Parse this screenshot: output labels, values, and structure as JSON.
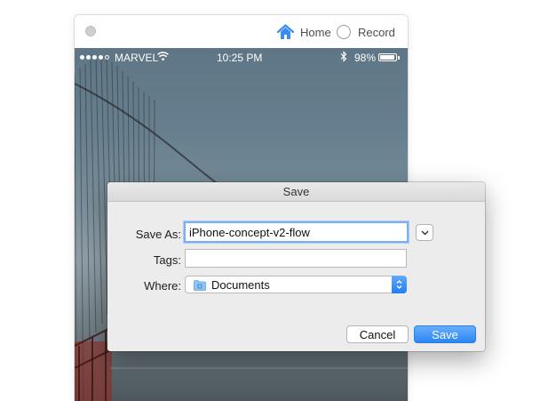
{
  "app": {
    "nav": {
      "home_label": "Home",
      "record_label": "Record"
    },
    "accent_color": "#3b8cf2"
  },
  "phone": {
    "status": {
      "carrier": "MARVEL",
      "time": "10:25 PM",
      "battery": "98%"
    }
  },
  "dialog": {
    "title": "Save",
    "save_as_label": "Save As:",
    "save_as_value": "iPhone-concept-v2-flow",
    "tags_label": "Tags:",
    "tags_value": "",
    "where_label": "Where:",
    "where_value": "Documents",
    "cancel_label": "Cancel",
    "save_label": "Save"
  }
}
